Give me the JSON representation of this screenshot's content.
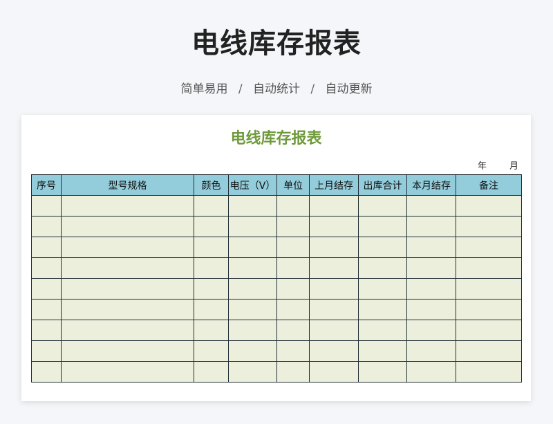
{
  "header": {
    "title": "电线库存报表",
    "tags": [
      "简单易用",
      "自动统计",
      "自动更新"
    ],
    "separator": "/"
  },
  "sheet": {
    "title": "电线库存报表",
    "year_label": "年",
    "month_label": "月",
    "columns": [
      "序号",
      "型号规格",
      "颜色",
      "电压（V）",
      "单位",
      "上月结存",
      "出库合计",
      "本月结存",
      "备注"
    ],
    "row_count": 9
  },
  "colors": {
    "sheet_title": "#6f9a3b",
    "header_fill": "#93cddb",
    "cell_fill": "#ebefdc",
    "border": "#1f2a33"
  }
}
